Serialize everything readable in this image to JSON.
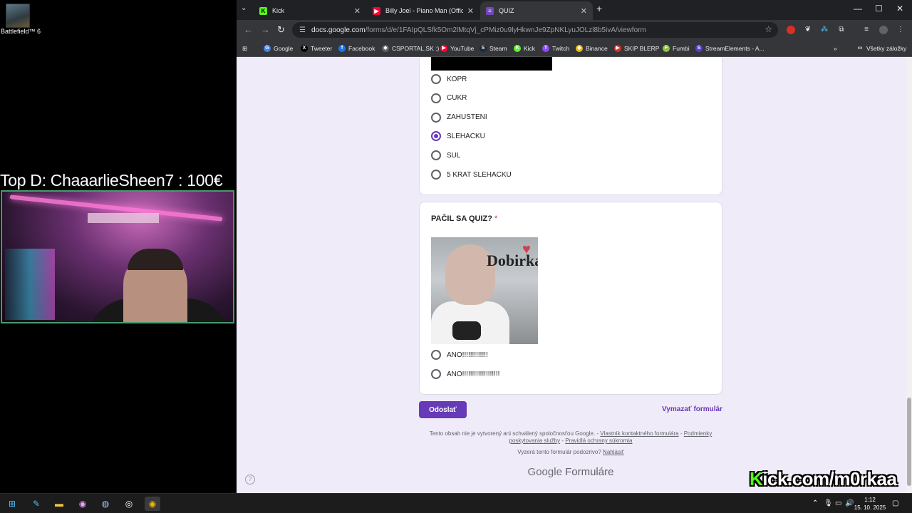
{
  "desktop": {
    "icon_label": "Battlefield™ 6"
  },
  "stream_overlay": {
    "donation_text": "Top D: ChaaarlieSheen7 : 100€",
    "watermark_prefix": "K",
    "watermark_text": "ick.com/m0rkaa"
  },
  "browser": {
    "tabs": [
      {
        "label": "Kick",
        "favicon": "kick-icon",
        "color": "#53fc18"
      },
      {
        "label": "Billy Joel - Piano Man (Official I",
        "favicon": "youtube-icon",
        "color": "#ff0033"
      },
      {
        "label": "QUIZ",
        "favicon": "forms-icon",
        "color": "#7248b9"
      }
    ],
    "url_host": "docs.google.com",
    "url_path": "/forms/d/e/1FAIpQLSfk5Om2lMtqVj_cPMiz0u9lyHkwnJe9ZpNKLyuJOLzl8b5ivA/viewform",
    "bookmarks": [
      {
        "label": "Google",
        "color": "#4285f4",
        "glyph": "G"
      },
      {
        "label": "Tweeter",
        "color": "#000000",
        "glyph": "X"
      },
      {
        "label": "Facebook",
        "color": "#1877f2",
        "glyph": "f"
      },
      {
        "label": "CSPORTAL.SK :)",
        "color": "#5f6368",
        "glyph": "◆"
      },
      {
        "label": "YouTube",
        "color": "#ff0033",
        "glyph": "▶"
      },
      {
        "label": "Steam",
        "color": "#1b2838",
        "glyph": "S"
      },
      {
        "label": "Kick",
        "color": "#53fc18",
        "glyph": "K"
      },
      {
        "label": "Twitch",
        "color": "#9146ff",
        "glyph": "T"
      },
      {
        "label": "Binance",
        "color": "#f0b90b",
        "glyph": "◆"
      },
      {
        "label": "SKIP BLERP",
        "color": "#d93025",
        "glyph": "▶"
      },
      {
        "label": "Fumbi",
        "color": "#8bc34a",
        "glyph": "F"
      },
      {
        "label": "StreamElements - A...",
        "color": "#5a3fd1",
        "glyph": "S"
      }
    ],
    "all_bookmarks_label": "Všetky záložky"
  },
  "form": {
    "options_q1": [
      {
        "label": "KOPR",
        "checked": false
      },
      {
        "label": "CUKR",
        "checked": false
      },
      {
        "label": "ZAHUSTENI",
        "checked": false
      },
      {
        "label": "SLEHACKU",
        "checked": true
      },
      {
        "label": "SUL",
        "checked": false
      },
      {
        "label": "5 KRAT SLEHACKU",
        "checked": false
      }
    ],
    "q2_title": "PAČIL SA QUIZ?",
    "q2_required_mark": "*",
    "q2_image_text": "Dobirka",
    "options_q2": [
      {
        "label": "ANO!!!!!!!!!!!!!",
        "checked": false
      },
      {
        "label": "ANO!!!!!!!!!!!!!!!!!!!",
        "checked": false
      }
    ],
    "submit_label": "Odoslať",
    "clear_label": "Vymazať formulár",
    "footer_text_1": "Tento obsah nie je vytvorený ani schválený spoločnosťou Google. -",
    "footer_link_1": "Vlastník kontaktného formulára",
    "footer_sep": "-",
    "footer_link_2": "Podmienky poskytovania služby",
    "footer_sep2": "-",
    "footer_link_3": "Pravidlá ochrany súkromia",
    "report_text": "Vyzerá tento formulár podozrivo?",
    "report_link": "Nahlásiť",
    "brand_google": "Google",
    "brand_forms": "Formuláre"
  },
  "taskbar": {
    "time": "1:12",
    "date": "15. 10. 2025"
  }
}
